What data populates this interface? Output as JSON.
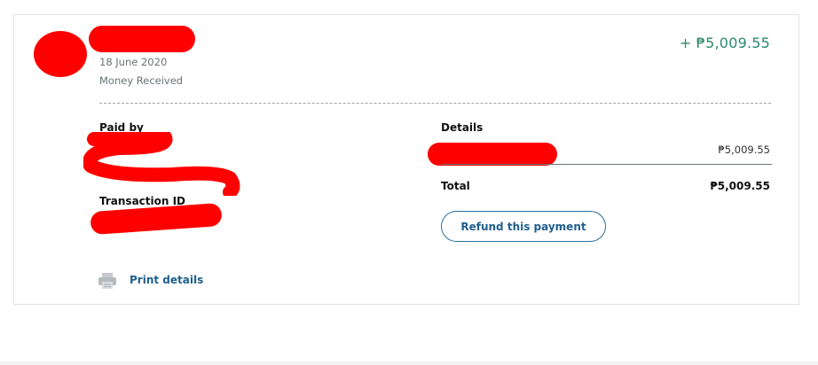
{
  "transaction": {
    "date": "18 June 2020",
    "type": "Money Received",
    "amount": "+ ₱5,009.55"
  },
  "paid_by": {
    "label": "Paid by"
  },
  "transaction_id": {
    "label": "Transaction ID"
  },
  "details": {
    "label": "Details",
    "line_amount": "₱5,009.55",
    "total_label": "Total",
    "total_amount": "₱5,009.55"
  },
  "actions": {
    "refund_label": "Refund this payment",
    "print_label": "Print details",
    "print_icon": "printer-icon"
  },
  "colors": {
    "amount_green": "#2b8a6e",
    "link_blue": "#1f5f8e",
    "redaction_red": "#ff0000"
  }
}
